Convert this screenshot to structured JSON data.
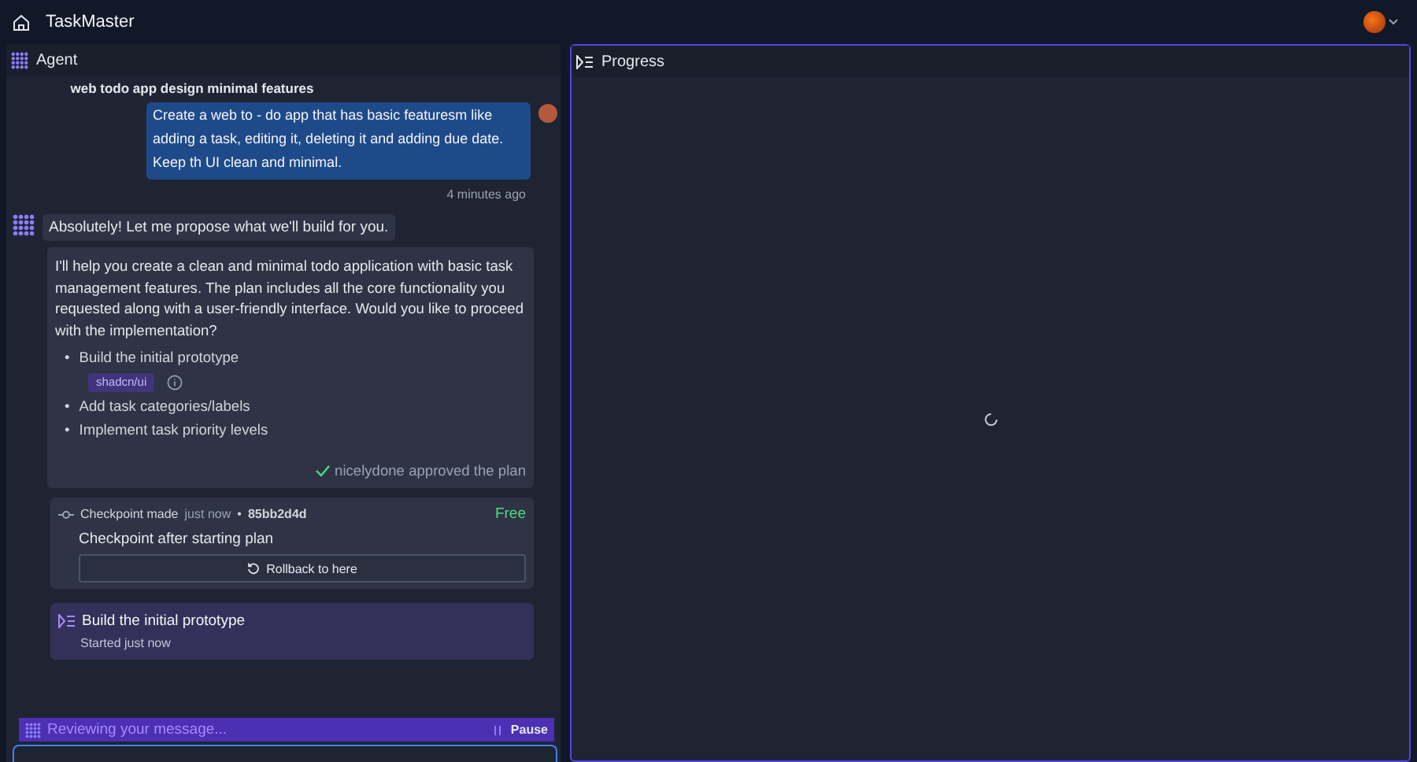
{
  "app": {
    "title": "TaskMaster"
  },
  "agent_panel": {
    "title": "Agent",
    "conversation_title": "web todo app design minimal features",
    "user_message": {
      "text": "Create a web to - do app that has basic featuresm like adding a task, editing it, deleting it and adding due date. Keep th UI clean and minimal.",
      "time": "4 minutes ago"
    },
    "agent_intro": "Absolutely! Let me propose what we'll build for you.",
    "plan": {
      "text": "I'll help you create a clean and minimal todo application with basic task management features. The plan includes all the core functionality you requested along with a user-friendly interface. Would you like to proceed with the implementation?",
      "items": [
        {
          "bullet": "•",
          "label": "Build the initial prototype",
          "tag": "shadcn/ui"
        },
        {
          "bullet": "•",
          "label": "Add task categories/labels"
        },
        {
          "bullet": "•",
          "label": "Implement task priority levels"
        }
      ],
      "approval": "nicelydone approved the plan"
    },
    "checkpoint": {
      "label": "Checkpoint made",
      "time": "just now",
      "separator": "•",
      "hash": "85bb2d4d",
      "price": "Free",
      "title": "Checkpoint after starting plan",
      "rollback": "Rollback to here"
    },
    "step": {
      "title": "Build the initial prototype",
      "status": "Started",
      "time": "just now"
    },
    "status_bar": {
      "text": "Reviewing your message...",
      "action": "Pause"
    }
  },
  "progress_panel": {
    "title": "Progress",
    "loading": true
  }
}
